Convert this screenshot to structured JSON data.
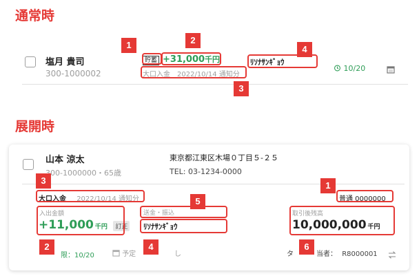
{
  "normal": {
    "section_title": "通常時",
    "name": "塩月 貴司",
    "customer_id": "300-1000002",
    "savings_tag": "貯蓄",
    "amount": "+31,000",
    "amount_unit": "千円",
    "notice": "大口入金　2022/10/14 通知分",
    "katakana_name": "ﾘｿﾅｻﾝｷﾞｮｳ",
    "alarm_date": "10/20",
    "markers": [
      "1",
      "2",
      "3",
      "4"
    ]
  },
  "expanded": {
    "section_title": "展開時",
    "name": "山本 涼太",
    "customer_info": "300-1000000・65歳",
    "address": "東京都江東区木場０丁目５-２５",
    "tel": "TEL: 03-1234-0000",
    "deposit_type": "大口入金",
    "notice_date": "2022/10/14 通知分",
    "account": "普通 0000000",
    "deposit_amount_label": "入出金額",
    "deposit_amount": "+11,000",
    "deposit_amount_unit": "千円",
    "correction_badge": "訂正",
    "transfer_label": "送金・振込",
    "transfer_name": "ﾘｿﾅｻﾝｷﾞｮｳ",
    "balance_label": "取引後残高",
    "balance": "10,000,000",
    "balance_unit": "千円",
    "deadline": "限：10/20",
    "scheduled": "予定",
    "scheduled_tail": "し",
    "assignee_prefix": "タ",
    "assignee": "当者：",
    "assignee_id": "R8000001",
    "markers": [
      "3",
      "1",
      "5",
      "2",
      "4",
      "6"
    ]
  },
  "colors": {
    "accent_red": "#e53935",
    "green": "#2e9d57"
  },
  "icons": {
    "alarm": "alarm-clock-icon",
    "calendar": "calendar-icon",
    "swap": "swap-arrows-icon"
  }
}
